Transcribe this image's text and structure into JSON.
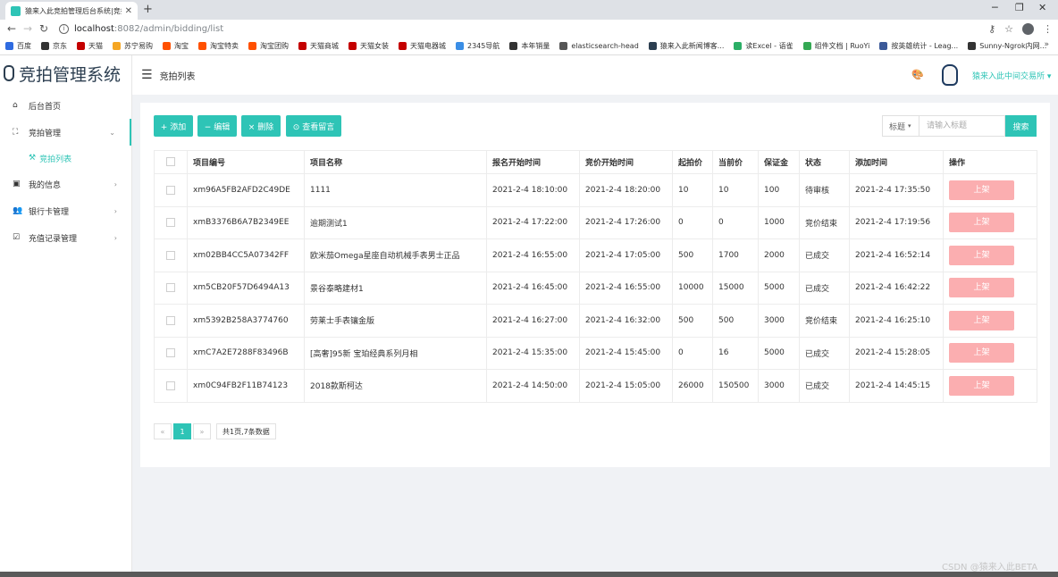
{
  "browser": {
    "tab_title": "猿来入此竞拍管理后台系统|竞拍...",
    "url_host": "localhost",
    "url_rest": ":8082/admin/bidding/list",
    "bookmarks": [
      {
        "label": "百度",
        "color": "#2f6be0"
      },
      {
        "label": "京东",
        "color": "#333333"
      },
      {
        "label": "天猫",
        "color": "#c40000"
      },
      {
        "label": "苏宁易购",
        "color": "#f5a623"
      },
      {
        "label": "淘宝",
        "color": "#ff5000"
      },
      {
        "label": "淘宝特卖",
        "color": "#ff5000"
      },
      {
        "label": "淘宝团购",
        "color": "#ff5000"
      },
      {
        "label": "天猫商城",
        "color": "#c40000"
      },
      {
        "label": "天猫女装",
        "color": "#c40000"
      },
      {
        "label": "天猫电器城",
        "color": "#c40000"
      },
      {
        "label": "2345导航",
        "color": "#3a8ee6"
      },
      {
        "label": "本年销量",
        "color": "#333333"
      },
      {
        "label": "elasticsearch-head",
        "color": "#555555"
      },
      {
        "label": "猿来入此新闻博客...",
        "color": "#2c3e50"
      },
      {
        "label": "读Excel - 语雀",
        "color": "#2bae66"
      },
      {
        "label": "组件文档 | RuoYi",
        "color": "#34a853"
      },
      {
        "label": "按英雄统计 - Leag...",
        "color": "#3b5998"
      },
      {
        "label": "Sunny-Ngrok内网...",
        "color": "#333333"
      }
    ]
  },
  "app": {
    "logo_text": "竞拍管理系统",
    "breadcrumb": "竞拍列表",
    "user_name": "猿来入此中间交易所",
    "accent": "#2ec4b6"
  },
  "sidebar": {
    "items": [
      {
        "label": "后台首页",
        "icon": "home-icon"
      },
      {
        "label": "竞拍管理",
        "icon": "sitemap-icon"
      },
      {
        "label": "竞拍列表",
        "icon": "gavel-icon"
      },
      {
        "label": "我的信息",
        "icon": "id-card-icon"
      },
      {
        "label": "银行卡管理",
        "icon": "users-icon"
      },
      {
        "label": "充值记录管理",
        "icon": "check-square-icon"
      }
    ]
  },
  "toolbar": {
    "add": "+ 添加",
    "edit": "− 编辑",
    "delete": "× 删除",
    "view": "⊙ 查看留言",
    "select_value": "标题",
    "search_placeholder": "请输入标题",
    "search_button": "搜索"
  },
  "table": {
    "headers": [
      "项目编号",
      "项目名称",
      "报名开始时间",
      "竞价开始时间",
      "起拍价",
      "当前价",
      "保证金",
      "状态",
      "添加时间",
      "操作"
    ],
    "rows": [
      {
        "code": "xm96A5FB2AFD2C49DE",
        "name": "1111",
        "signup": "2021-2-4 18:10:00",
        "bid_start": "2021-2-4 18:20:00",
        "start_price": "10",
        "current_price": "10",
        "deposit": "100",
        "status": "待审核",
        "added": "2021-2-4 17:35:50",
        "action": "上架"
      },
      {
        "code": "xmB3376B6A7B2349EE",
        "name": "逾期测试1",
        "signup": "2021-2-4 17:22:00",
        "bid_start": "2021-2-4 17:26:00",
        "start_price": "0",
        "current_price": "0",
        "deposit": "1000",
        "status": "竞价结束",
        "added": "2021-2-4 17:19:56",
        "action": "上架"
      },
      {
        "code": "xm02BB4CC5A07342FF",
        "name": "欧米茄Omega星座自动机械手表男士正品",
        "signup": "2021-2-4 16:55:00",
        "bid_start": "2021-2-4 17:05:00",
        "start_price": "500",
        "current_price": "1700",
        "deposit": "2000",
        "status": "已成交",
        "added": "2021-2-4 16:52:14",
        "action": "上架"
      },
      {
        "code": "xm5CB20F57D6494A13",
        "name": "景谷泰略建材1",
        "signup": "2021-2-4 16:45:00",
        "bid_start": "2021-2-4 16:55:00",
        "start_price": "10000",
        "current_price": "15000",
        "deposit": "5000",
        "status": "已成交",
        "added": "2021-2-4 16:42:22",
        "action": "上架"
      },
      {
        "code": "xm5392B258A3774760",
        "name": "劳莱士手表镶金版",
        "signup": "2021-2-4 16:27:00",
        "bid_start": "2021-2-4 16:32:00",
        "start_price": "500",
        "current_price": "500",
        "deposit": "3000",
        "status": "竞价结束",
        "added": "2021-2-4 16:25:10",
        "action": "上架"
      },
      {
        "code": "xmC7A2E7288F83496B",
        "name": "[高奢]95新 宝珀经典系列月相",
        "signup": "2021-2-4 15:35:00",
        "bid_start": "2021-2-4 15:45:00",
        "start_price": "0",
        "current_price": "16",
        "deposit": "5000",
        "status": "已成交",
        "added": "2021-2-4 15:28:05",
        "action": "上架"
      },
      {
        "code": "xm0C94FB2F11B74123",
        "name": "2018款斯柯达",
        "signup": "2021-2-4 14:50:00",
        "bid_start": "2021-2-4 15:05:00",
        "start_price": "26000",
        "current_price": "150500",
        "deposit": "3000",
        "status": "已成交",
        "added": "2021-2-4 14:45:15",
        "action": "上架"
      }
    ]
  },
  "pager": {
    "prev": "«",
    "current": "1",
    "next": "»",
    "total": "共1页,7条数据"
  },
  "watermark": "CSDN @猿来入此BETA"
}
